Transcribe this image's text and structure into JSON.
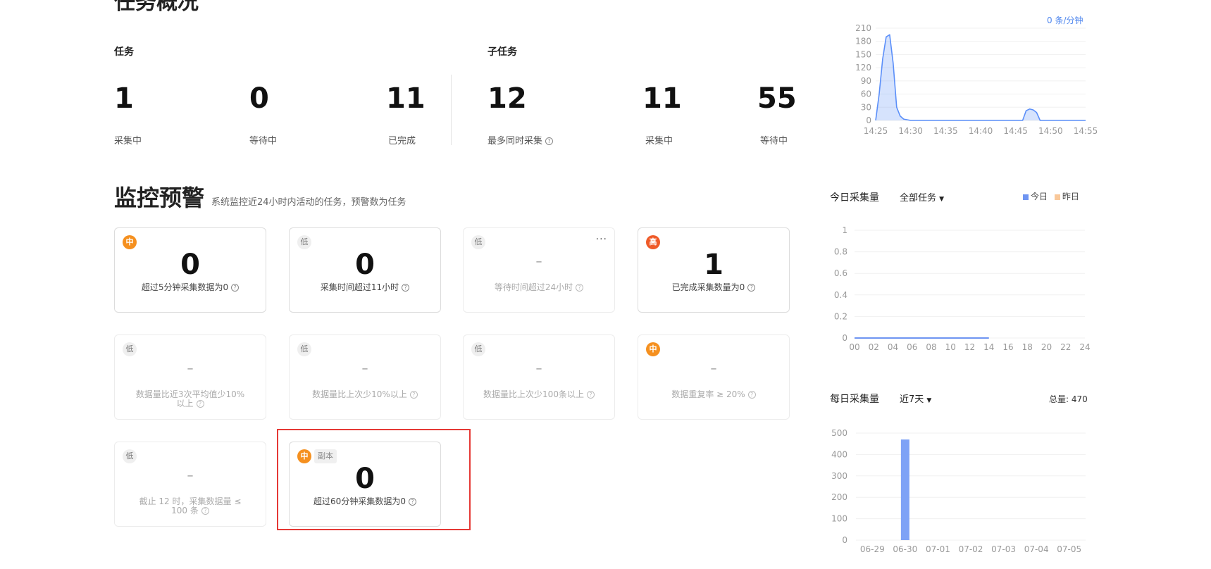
{
  "overview": {
    "title": "任务概况",
    "task_section": "任务",
    "subtask_section": "子任务",
    "stats": [
      {
        "value": "1",
        "label": "采集中"
      },
      {
        "value": "0",
        "label": "等待中"
      },
      {
        "value": "11",
        "label": "已完成"
      },
      {
        "value": "12",
        "label": "最多同时采集"
      },
      {
        "value": "11",
        "label": "采集中"
      },
      {
        "value": "55",
        "label": "等待中"
      }
    ]
  },
  "monitor": {
    "title": "监控预警",
    "subtitle": "系统监控近24小时内活动的任务，预警数为任务",
    "help_glyph": "?",
    "more_glyph": "···",
    "cards": [
      {
        "level": "中",
        "level_type": "mid",
        "value": "0",
        "desc": "超过5分钟采集数据为0",
        "active": true
      },
      {
        "level": "低",
        "level_type": "low",
        "value": "0",
        "desc": "采集时间超过11小时",
        "active": true
      },
      {
        "level": "低",
        "level_type": "low",
        "value": "–",
        "desc": "等待时间超过24小时",
        "active": false
      },
      {
        "level": "高",
        "level_type": "high",
        "value": "1",
        "desc": "已完成采集数量为0",
        "active": true
      },
      {
        "level": "低",
        "level_type": "low",
        "value": "–",
        "desc": "数据量比近3次平均值少10%以上",
        "active": false
      },
      {
        "level": "低",
        "level_type": "low",
        "value": "–",
        "desc": "数据量比上次少10%以上",
        "active": false
      },
      {
        "level": "低",
        "level_type": "low",
        "value": "–",
        "desc": "数据量比上次少100条以上",
        "active": false
      },
      {
        "level": "中",
        "level_type": "mid",
        "value": "–",
        "desc": "数据重复率 ≥ 20%",
        "active": false
      },
      {
        "level": "低",
        "level_type": "low",
        "value": "–",
        "desc": "截止 12 时，采集数据量 ≤ 100 条",
        "active": false
      },
      {
        "level": "中",
        "level_type": "mid",
        "tag": "副本",
        "value": "0",
        "desc": "超过60分钟采集数据为0",
        "active": true
      }
    ]
  },
  "rate_chart": {
    "rate_label": "0 条/分钟",
    "color": "#5b8ff9"
  },
  "today_panel": {
    "title": "今日采集量",
    "filter": "全部任务",
    "legend_today": "今日",
    "legend_yesterday": "昨日",
    "today_color": "#6f95f2",
    "yesterday_color": "#f9c89a"
  },
  "daily_panel": {
    "title": "每日采集量",
    "filter": "近7天",
    "total": "总量: 470",
    "bar_color": "#7ea2f6"
  },
  "chart_data": [
    {
      "type": "area",
      "x_tick_labels": [
        "14:25",
        "14:30",
        "14:35",
        "14:40",
        "14:45",
        "14:50",
        "14:55"
      ],
      "y_tick_labels": [
        "0",
        "30",
        "60",
        "90",
        "120",
        "150",
        "180",
        "210"
      ],
      "ylim": [
        0,
        210
      ],
      "x_minutes": [
        0,
        0.5,
        1,
        1.5,
        2,
        2.5,
        3,
        3.5,
        4,
        5,
        10,
        15,
        20,
        21,
        21.5,
        22,
        22.5,
        23,
        23.5,
        25,
        30
      ],
      "values": [
        0,
        60,
        140,
        190,
        195,
        130,
        30,
        10,
        3,
        0,
        0,
        0,
        0,
        0,
        22,
        26,
        24,
        18,
        0,
        0,
        0
      ]
    },
    {
      "type": "line",
      "x_tick_labels": [
        "00",
        "02",
        "04",
        "06",
        "08",
        "10",
        "12",
        "14",
        "16",
        "18",
        "20",
        "22",
        "24"
      ],
      "y_tick_labels": [
        "0",
        "0.2",
        "0.4",
        "0.6",
        "0.8",
        "1"
      ],
      "ylim": [
        0,
        1
      ],
      "series": [
        {
          "x": [
            0,
            14
          ],
          "values": [
            0,
            0
          ]
        }
      ]
    },
    {
      "type": "bar",
      "categories": [
        "06-29",
        "06-30",
        "07-01",
        "07-02",
        "07-03",
        "07-04",
        "07-05"
      ],
      "values": [
        0,
        470,
        0,
        0,
        0,
        0,
        0
      ],
      "y_tick_labels": [
        "0",
        "100",
        "200",
        "300",
        "400",
        "500"
      ],
      "ylim": [
        0,
        500
      ]
    }
  ]
}
